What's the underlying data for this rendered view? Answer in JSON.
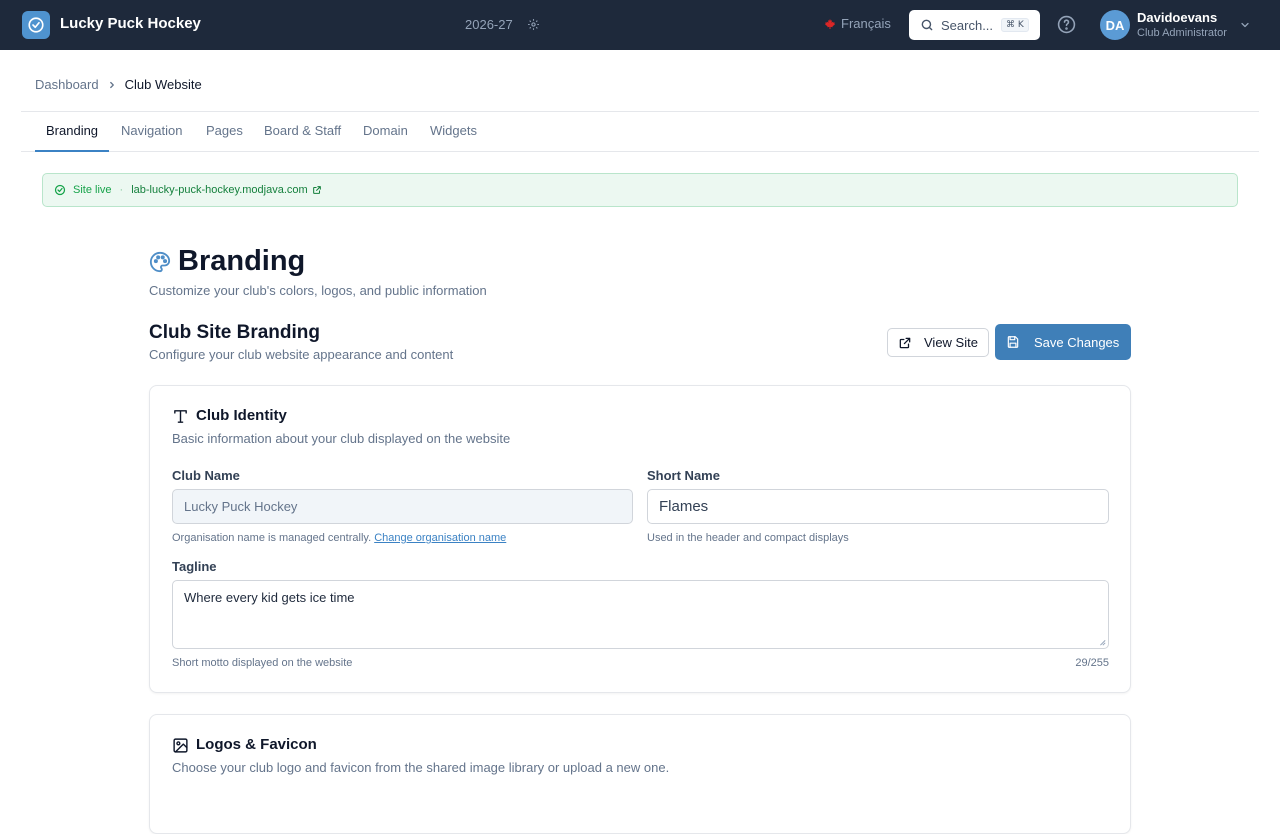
{
  "app": {
    "title": "Lucky Puck Hockey",
    "season": "2026-27",
    "language": "Français",
    "search_label": "Search...",
    "search_shortcut": "⌘ K"
  },
  "user": {
    "initials": "DA",
    "name": "Davidoevans",
    "role": "Club Administrator"
  },
  "breadcrumb": {
    "parent": "Dashboard",
    "current": "Club Website"
  },
  "tabs": [
    {
      "label": "Branding"
    },
    {
      "label": "Navigation"
    },
    {
      "label": "Pages"
    },
    {
      "label": "Board & Staff"
    },
    {
      "label": "Domain"
    },
    {
      "label": "Widgets"
    }
  ],
  "status": {
    "label": "Site live",
    "separator": "·",
    "url": "lab-lucky-puck-hockey.modjava.com"
  },
  "page": {
    "title": "Branding",
    "subtitle": "Customize your club's colors, logos, and public information"
  },
  "section": {
    "title": "Club Site Branding",
    "subtitle": "Configure your club website appearance and content",
    "view_label": "View Site",
    "save_label": "Save Changes"
  },
  "identity": {
    "title": "Club Identity",
    "description": "Basic information about your club displayed on the website",
    "club_name_label": "Club Name",
    "club_name_value": "Lucky Puck Hockey",
    "club_name_hint": "Organisation name is managed centrally.",
    "club_name_link": "Change organisation name",
    "short_name_label": "Short Name",
    "short_name_value": "Flames",
    "short_name_hint": "Used in the header and compact displays",
    "tagline_label": "Tagline",
    "tagline_value": "Where every kid gets ice time",
    "tagline_hint": "Short motto displayed on the website",
    "tagline_count": "29/255"
  },
  "logos": {
    "title": "Logos & Favicon",
    "description": "Choose your club logo and favicon from the shared image library or upload a new one."
  },
  "colors": {
    "topbar": "#1e293b",
    "accent": "#3f7fb8",
    "live_green": "#16a34a"
  }
}
